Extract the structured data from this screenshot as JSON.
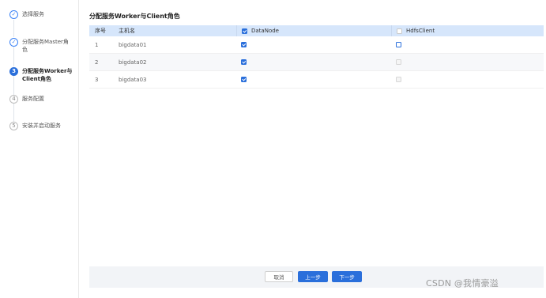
{
  "steps": [
    {
      "label": "选择服务",
      "state": "done",
      "mark": "✓"
    },
    {
      "label": "分配服务Master角\n色",
      "state": "done",
      "mark": "✓"
    },
    {
      "label": "分配服务Worker与\nClient角色",
      "state": "active",
      "mark": "3"
    },
    {
      "label": "服务配置",
      "state": "todo",
      "mark": "4"
    },
    {
      "label": "安装并启动服务",
      "state": "todo",
      "mark": "5"
    }
  ],
  "main": {
    "title": "分配服务Worker与Client角色"
  },
  "table": {
    "headers": {
      "index": "序号",
      "hostname": "主机名",
      "datanode": "DataNode",
      "hdfsclient": "HdfsClient"
    },
    "rows": [
      {
        "index": "1",
        "hostname": "bigdata01",
        "datanode": true,
        "hdfsclient": false,
        "hdfsclient_enabled": true
      },
      {
        "index": "2",
        "hostname": "bigdata02",
        "datanode": true,
        "hdfsclient": false,
        "hdfsclient_enabled": false
      },
      {
        "index": "3",
        "hostname": "bigdata03",
        "datanode": true,
        "hdfsclient": false,
        "hdfsclient_enabled": false
      }
    ]
  },
  "footer": {
    "cancel_label": "取消",
    "prev_label": "上一步",
    "next_label": "下一步"
  },
  "watermark": "CSDN @我情豪溢",
  "colors": {
    "accent": "#2a6fdb",
    "header_bg": "#d6e6fb",
    "footer_bg": "#f2f4f7"
  }
}
